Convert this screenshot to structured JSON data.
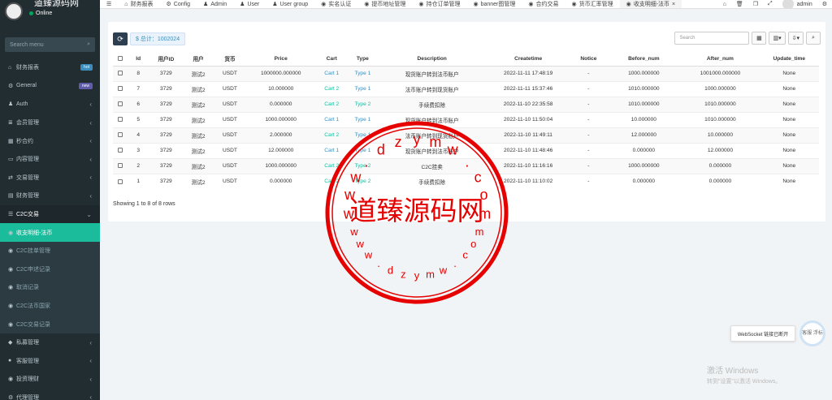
{
  "sidebar": {
    "brand": "道臻源码网",
    "status": "Online",
    "search_placeholder": "Search menu",
    "items": [
      {
        "label": "财务报表",
        "icon": "bank-icon",
        "badge": "hot",
        "badge_color": "#3c8dbc"
      },
      {
        "label": "General",
        "icon": "cogs-icon",
        "badge": "new",
        "badge_color": "#605ca8"
      },
      {
        "label": "Auth",
        "icon": "group-icon",
        "chevron": true
      },
      {
        "label": "会员管理",
        "icon": "list-icon",
        "chevron": true
      },
      {
        "label": "秒合约",
        "icon": "calendar-icon",
        "chevron": true
      },
      {
        "label": "内容管理",
        "icon": "folder-icon",
        "chevron": true
      },
      {
        "label": "交易管理",
        "icon": "exchange-icon",
        "chevron": true
      },
      {
        "label": "财务管理",
        "icon": "money-icon",
        "chevron": true
      },
      {
        "label": "C2C交易",
        "icon": "stack-icon",
        "chevron": true,
        "open": true
      }
    ],
    "subitems": [
      {
        "label": "收支明细-法币",
        "active": true
      },
      {
        "label": "C2C挂单管理"
      },
      {
        "label": "C2C申述记录"
      },
      {
        "label": "取消记录"
      },
      {
        "label": "C2C法币国家"
      },
      {
        "label": "C2C交易记录"
      }
    ],
    "items_after": [
      {
        "label": "私募管理",
        "icon": "diamond-icon"
      },
      {
        "label": "客服管理",
        "icon": "comment-icon"
      },
      {
        "label": "投资理财",
        "icon": "circle-icon"
      },
      {
        "label": "代理管理",
        "icon": "gear-icon"
      }
    ]
  },
  "topbar": {
    "tabs": [
      "财务报表",
      "Config",
      "Admin",
      "User",
      "User group",
      "实名认证",
      "提币地址管理",
      "持仓订单管理",
      "banner图管理",
      "合约交易",
      "货币汇率管理",
      "收支明细-法币"
    ],
    "tab_icons": [
      "bank-icon",
      "cog-icon",
      "user-icon",
      "user-icon",
      "group-icon",
      "circle-icon",
      "circle-icon",
      "circle-icon",
      "circle-icon",
      "circle-icon",
      "circle-icon",
      "circle-icon"
    ],
    "active_tab": 11,
    "admin": "admin"
  },
  "toolbar": {
    "total_label": "$ 总计：1002024",
    "search_placeholder": "Search"
  },
  "table": {
    "columns": [
      "Id",
      "用户ID",
      "用户",
      "货币",
      "Price",
      "Cart",
      "Type",
      "Description",
      "Createtime",
      "Notice",
      "Before_num",
      "After_num",
      "Update_time"
    ],
    "rows": [
      [
        "8",
        "3729",
        "测试2",
        "USDT",
        "1000000.000000",
        "Cart 1",
        "Type 1",
        "现货账户转到法币账户",
        "2022-11-11 17:48:19",
        "-",
        "1000.000000",
        "1001000.000000",
        "None"
      ],
      [
        "7",
        "3729",
        "测试2",
        "USDT",
        "10.000000",
        "Cart 2",
        "Type 1",
        "法币账户转到现货账户",
        "2022-11-11 15:37:46",
        "-",
        "1010.000000",
        "1000.000000",
        "None"
      ],
      [
        "6",
        "3729",
        "测试2",
        "USDT",
        "0.000000",
        "Cart 2",
        "Type 2",
        "手续费扣除",
        "2022-11-10 22:35:58",
        "-",
        "1010.000000",
        "1010.000000",
        "None"
      ],
      [
        "5",
        "3729",
        "测试2",
        "USDT",
        "1000.000000",
        "Cart 1",
        "Type 1",
        "现货账户转到法币账户",
        "2022-11-10 11:50:04",
        "-",
        "10.000000",
        "1010.000000",
        "None"
      ],
      [
        "4",
        "3729",
        "测试2",
        "USDT",
        "2.000000",
        "Cart 2",
        "Type 1",
        "法币账户转到现货账户",
        "2022-11-10 11:49:11",
        "-",
        "12.000000",
        "10.000000",
        "None"
      ],
      [
        "3",
        "3729",
        "测试2",
        "USDT",
        "12.000000",
        "Cart 1",
        "Type 1",
        "现货账户转到法币账户",
        "2022-11-10 11:48:46",
        "-",
        "0.000000",
        "12.000000",
        "None"
      ],
      [
        "2",
        "3729",
        "测试2",
        "USDT",
        "1000.000000",
        "Cart 2",
        "Type 2",
        "C2C挂卖",
        "2022-11-10 11:16:16",
        "-",
        "1000.000000",
        "0.000000",
        "None"
      ],
      [
        "1",
        "3729",
        "测试2",
        "USDT",
        "0.000000",
        "Cart 2",
        "Type 2",
        "手续费扣除",
        "2022-11-10 11:10:02",
        "-",
        "0.000000",
        "0.000000",
        "None"
      ]
    ],
    "showing": "Showing 1 to 8 of 8 rows"
  },
  "watermark": {
    "center": "道臻源码网",
    "url": "www.dzymw.com",
    "color": "#e60000"
  },
  "ws_toast": "WebSocket 链接已断开",
  "kf_label": "客服 浮标",
  "windows": {
    "line1": "激活 Windows",
    "line2": "转到\"设置\"以激活 Windows。"
  }
}
